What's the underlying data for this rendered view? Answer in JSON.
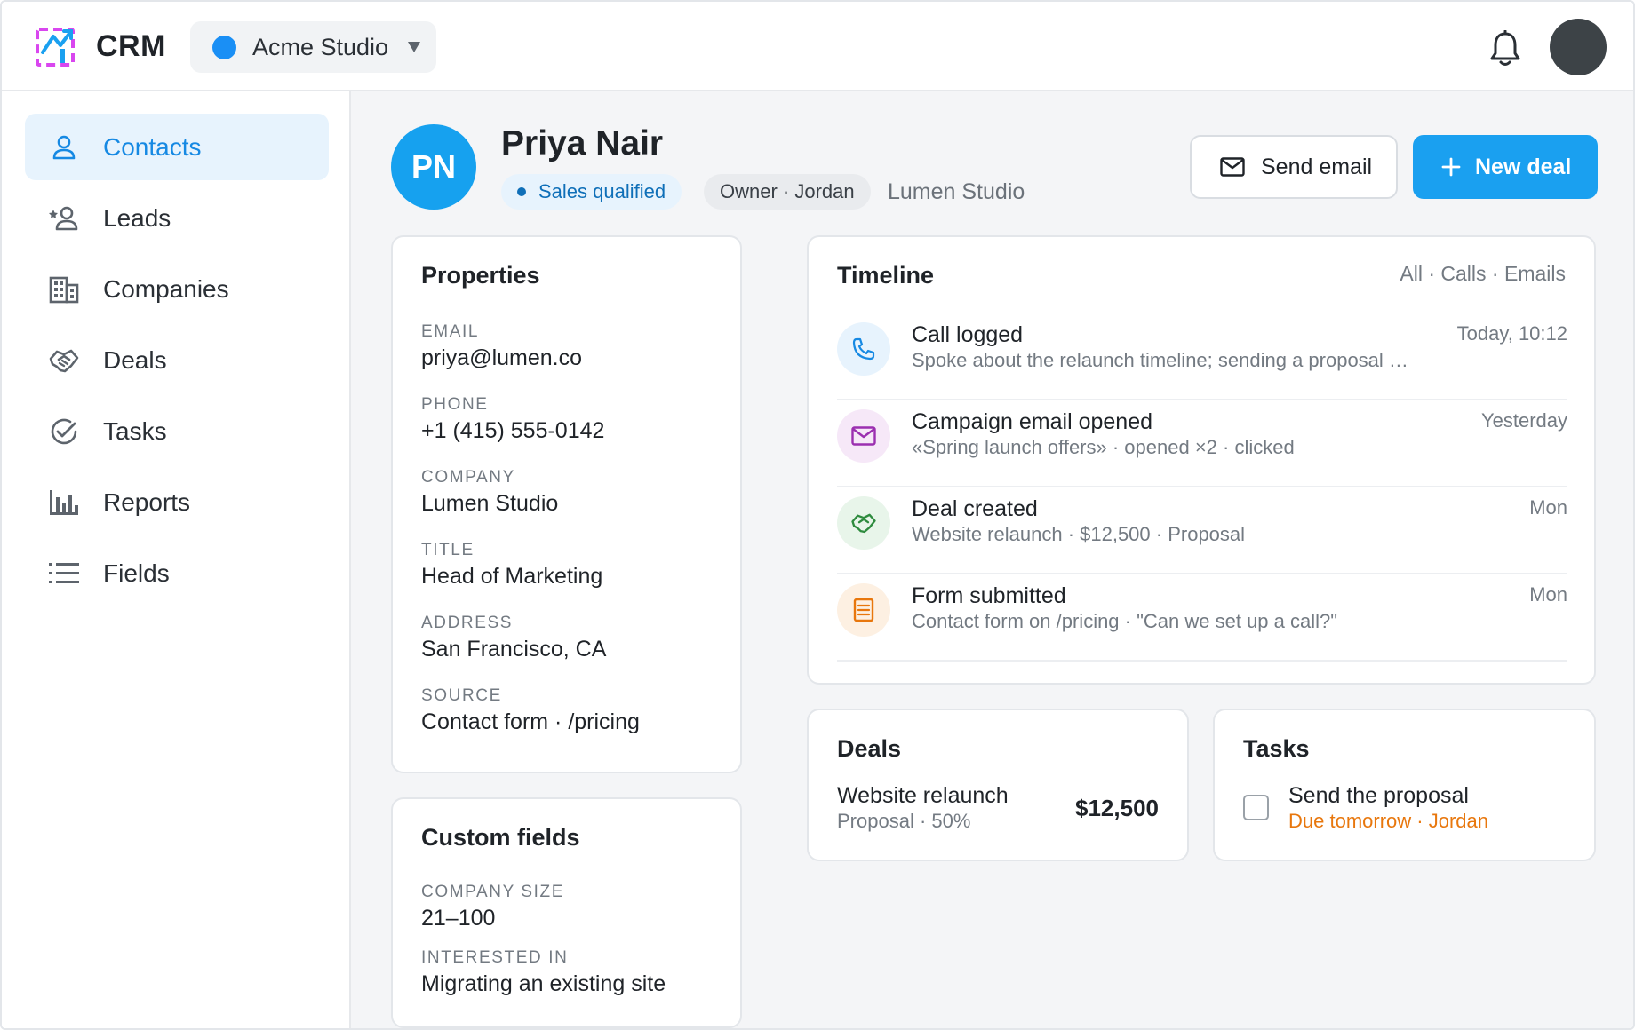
{
  "app": {
    "name": "CRM"
  },
  "workspace": {
    "name": "Acme Studio",
    "color": "#1a8ff5"
  },
  "sidebar": {
    "items": [
      {
        "label": "Contacts",
        "icon": "user-icon",
        "active": true
      },
      {
        "label": "Leads",
        "icon": "user-star-icon",
        "active": false
      },
      {
        "label": "Companies",
        "icon": "building-icon",
        "active": false
      },
      {
        "label": "Deals",
        "icon": "handshake-icon",
        "active": false
      },
      {
        "label": "Tasks",
        "icon": "check-circle-icon",
        "active": false
      },
      {
        "label": "Reports",
        "icon": "bar-chart-icon",
        "active": false
      },
      {
        "label": "Fields",
        "icon": "list-icon",
        "active": false
      }
    ]
  },
  "contact": {
    "initials": "PN",
    "name": "Priya Nair",
    "status": "Sales qualified",
    "owner": "Owner · Jordan",
    "company": "Lumen Studio"
  },
  "actions": {
    "send_email": "Send email",
    "new_deal": "New deal"
  },
  "properties": {
    "title": "Properties",
    "fields": [
      {
        "label": "EMAIL",
        "value": "priya@lumen.co"
      },
      {
        "label": "PHONE",
        "value": "+1 (415) 555-0142"
      },
      {
        "label": "COMPANY",
        "value": "Lumen Studio"
      },
      {
        "label": "TITLE",
        "value": "Head of Marketing"
      },
      {
        "label": "ADDRESS",
        "value": "San Francisco, CA"
      },
      {
        "label": "SOURCE",
        "value": "Contact form · /pricing"
      }
    ]
  },
  "custom_fields": {
    "title": "Custom fields",
    "fields": [
      {
        "label": "COMPANY SIZE",
        "value": "21–100"
      },
      {
        "label": "INTERESTED IN",
        "value": "Migrating an existing site"
      }
    ]
  },
  "timeline": {
    "title": "Timeline",
    "filters": [
      "All",
      "Calls",
      "Emails"
    ],
    "items": [
      {
        "icon": "phone-icon",
        "title": "Call logged",
        "subtitle": "Spoke about the relaunch timeline; sending a proposal …",
        "time": "Today, 10:12",
        "color": "#1689e3"
      },
      {
        "icon": "mail-icon",
        "title": "Campaign email opened",
        "subtitle": "«Spring launch offers» · opened ×2 · clicked",
        "time": "Yesterday",
        "color": "#9b2fb0"
      },
      {
        "icon": "handshake-icon",
        "title": "Deal created",
        "subtitle": "Website relaunch · $12,500 · Proposal",
        "time": "Mon",
        "color": "#2e8b3e"
      },
      {
        "icon": "form-icon",
        "title": "Form submitted",
        "subtitle": "Contact form on /pricing · \"Can we set up a call?\"",
        "time": "Mon",
        "color": "#e8770d"
      }
    ]
  },
  "deals": {
    "title": "Deals",
    "name": "Website relaunch",
    "stage": "Proposal · 50%",
    "amount": "$12,500"
  },
  "tasks": {
    "title": "Tasks",
    "name": "Send the proposal",
    "due": "Due tomorrow · Jordan",
    "due_color": "#e8770d"
  },
  "colors": {
    "accent": "#1aa0f0",
    "active_nav_bg": "#e7f3fd",
    "active_nav_text": "#1689e3"
  }
}
